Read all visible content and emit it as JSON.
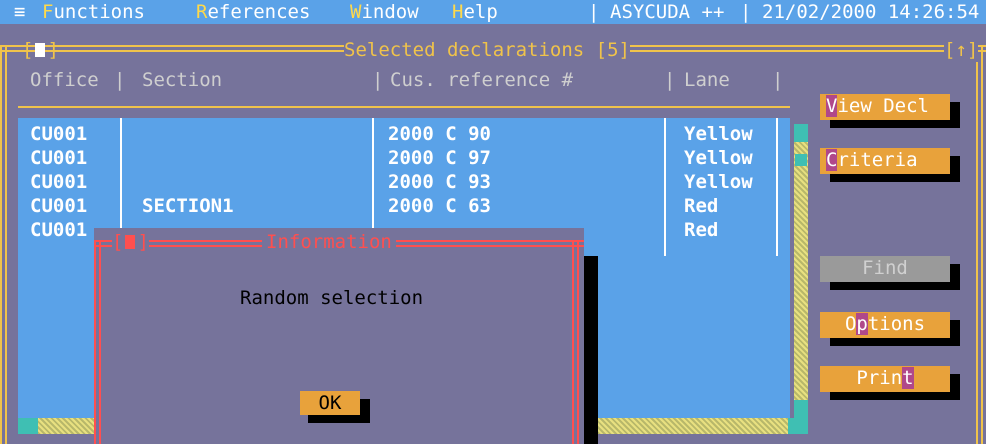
{
  "menubar": {
    "system_icon": "≡",
    "items": [
      {
        "hot": "F",
        "rest": "unctions"
      },
      {
        "hot": "R",
        "rest": "eferences"
      },
      {
        "hot": "W",
        "rest": "indow"
      },
      {
        "hot": "H",
        "rest": "elp"
      }
    ],
    "app_name": "ASYCUDA ++",
    "datetime": "21/02/2000 14:26:54"
  },
  "window": {
    "title": "Selected declarations [5]",
    "close_symbol": "[■]",
    "resize_symbol": "[↑]"
  },
  "table": {
    "headers": [
      "Office",
      "Section",
      "Cus. reference #",
      "Lane"
    ],
    "rows": [
      {
        "office": "CU001",
        "section": "",
        "reference": "2000 C 90",
        "lane": "Yellow"
      },
      {
        "office": "CU001",
        "section": "",
        "reference": "2000 C 97",
        "lane": "Yellow"
      },
      {
        "office": "CU001",
        "section": "",
        "reference": "2000 C 93",
        "lane": "Yellow"
      },
      {
        "office": "CU001",
        "section": "SECTION1",
        "reference": "2000 C 63",
        "lane": "Red"
      },
      {
        "office": "CU001",
        "section": "",
        "reference": "",
        "lane": "Red"
      }
    ]
  },
  "buttons": {
    "view_decl": {
      "key": "V",
      "rest": "iew Decl"
    },
    "criteria": {
      "key": "C",
      "rest": "riteria"
    },
    "find": "Find",
    "options": {
      "pre": "O",
      "key": "p",
      "rest": "tions"
    },
    "print": {
      "pre": "Prin",
      "key": "t"
    }
  },
  "dialog": {
    "title": "Information",
    "message": "Random selection",
    "ok_label": "OK"
  },
  "colors": {
    "background": "#76739b",
    "list_background": "#5aa2e8",
    "frame": "#f0c34a",
    "dialog_frame": "#ff4f4f",
    "button": "#e8a23b"
  }
}
